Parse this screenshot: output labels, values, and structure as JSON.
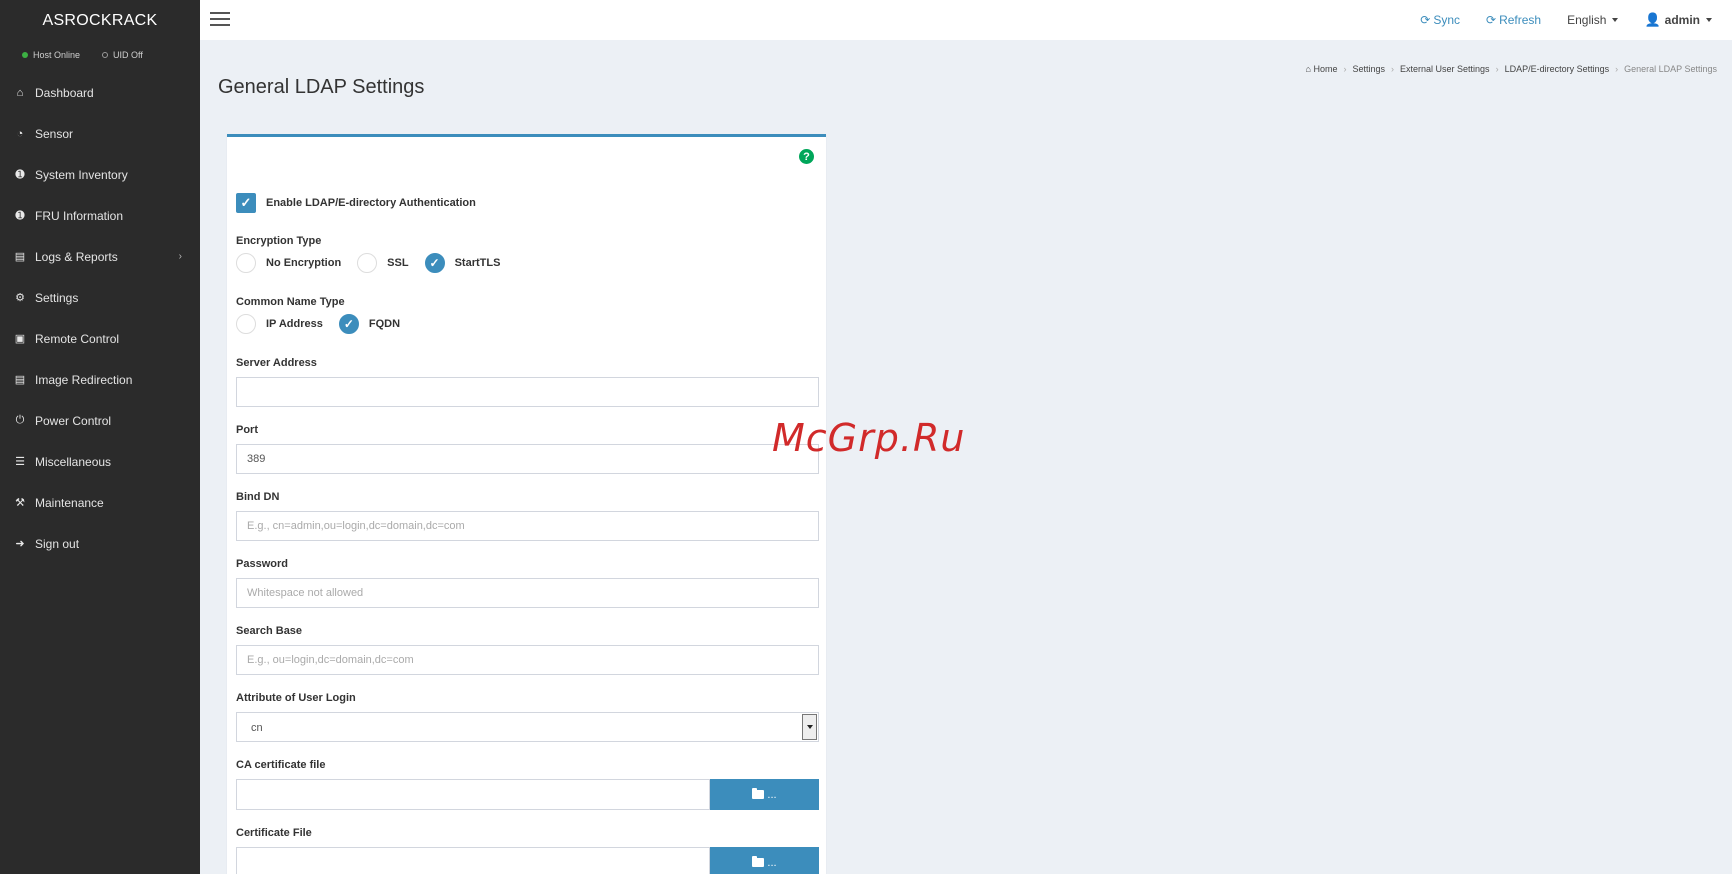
{
  "app": {
    "brand": "ASROCKRACK"
  },
  "status": {
    "host": "Host Online",
    "uid": "UID Off"
  },
  "sidebar": {
    "items": [
      {
        "label": "Dashboard",
        "icon": "home-icon"
      },
      {
        "label": "Sensor",
        "icon": "dashboard-gauge-icon"
      },
      {
        "label": "System Inventory",
        "icon": "info-circle-icon"
      },
      {
        "label": "FRU Information",
        "icon": "info-circle-icon"
      },
      {
        "label": "Logs & Reports",
        "icon": "bar-chart-icon",
        "has_submenu": true
      },
      {
        "label": "Settings",
        "icon": "gear-icon"
      },
      {
        "label": "Remote Control",
        "icon": "monitor-icon"
      },
      {
        "label": "Image Redirection",
        "icon": "hdd-icon"
      },
      {
        "label": "Power Control",
        "icon": "power-icon"
      },
      {
        "label": "Miscellaneous",
        "icon": "list-icon"
      },
      {
        "label": "Maintenance",
        "icon": "wrench-icon"
      },
      {
        "label": "Sign out",
        "icon": "sign-out-icon"
      }
    ]
  },
  "topbar": {
    "sync": "Sync",
    "refresh": "Refresh",
    "language": "English",
    "user": "admin"
  },
  "page": {
    "title": "General LDAP Settings"
  },
  "breadcrumb": [
    "Home",
    "Settings",
    "External User Settings",
    "LDAP/E-directory Settings",
    "General LDAP Settings"
  ],
  "form": {
    "enable_label": "Enable LDAP/E-directory Authentication",
    "enable_checked": true,
    "encryption": {
      "label": "Encryption Type",
      "options": [
        "No Encryption",
        "SSL",
        "StartTLS"
      ],
      "selected": "StartTLS"
    },
    "common_name": {
      "label": "Common Name Type",
      "options": [
        "IP Address",
        "FQDN"
      ],
      "selected": "FQDN"
    },
    "server_address": {
      "label": "Server Address",
      "value": "",
      "placeholder": ""
    },
    "port": {
      "label": "Port",
      "value": "389"
    },
    "bind_dn": {
      "label": "Bind DN",
      "placeholder": "E.g., cn=admin,ou=login,dc=domain,dc=com"
    },
    "password": {
      "label": "Password",
      "placeholder": "Whitespace not allowed"
    },
    "search_base": {
      "label": "Search Base",
      "placeholder": "E.g., ou=login,dc=domain,dc=com"
    },
    "user_login_attr": {
      "label": "Attribute of User Login",
      "value": "cn"
    },
    "ca_cert": {
      "label": "CA certificate file",
      "button": "..."
    },
    "cert_file": {
      "label": "Certificate File",
      "button": "..."
    }
  },
  "watermark": "McGrp.Ru",
  "colors": {
    "sidebar_bg": "#2b2b2b",
    "accent": "#3c8dbc",
    "help_green": "#00a65a",
    "watermark": "#d12a2a"
  }
}
